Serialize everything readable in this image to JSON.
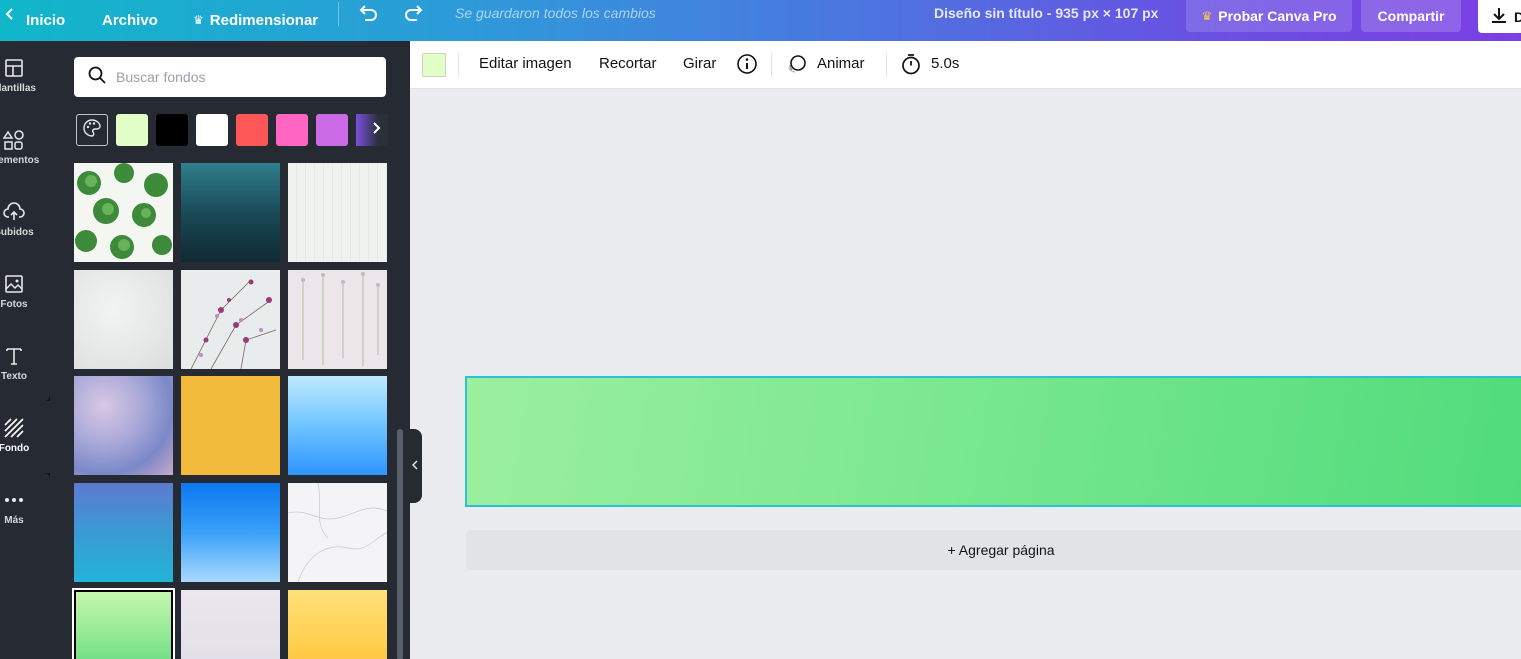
{
  "topbar": {
    "home_label": "Inicio",
    "file_label": "Archivo",
    "resize_label": "Redimensionar",
    "saved_status": "Se guardaron todos los cambios",
    "doc_title": "Diseño sin título - 935 px × 107 px",
    "try_pro_label": "Probar Canva Pro",
    "share_label": "Compartir",
    "download_label": "D"
  },
  "rail": {
    "items": [
      {
        "label": "Plantillas",
        "icon": "template-icon"
      },
      {
        "label": "Elementos",
        "icon": "shapes-icon"
      },
      {
        "label": "Subidos",
        "icon": "upload-cloud-icon"
      },
      {
        "label": "Fotos",
        "icon": "image-icon"
      },
      {
        "label": "Texto",
        "icon": "text-icon"
      },
      {
        "label": "Fondo",
        "icon": "background-stripes-icon"
      },
      {
        "label": "Más",
        "icon": "more-dots-icon"
      }
    ]
  },
  "panel": {
    "search_placeholder": "Buscar fondos",
    "swatch_colors": [
      "#e2ffc8",
      "#000000",
      "#ffffff",
      "#ff5757",
      "#ff66c4",
      "#cb6ce6"
    ]
  },
  "toolbar": {
    "edit_image_label": "Editar imagen",
    "crop_label": "Recortar",
    "flip_label": "Girar",
    "animate_label": "Animar",
    "duration_label": "5.0s",
    "bg_color": "#e2ffc8"
  },
  "canvas": {
    "add_page_label": "+ Agregar página"
  },
  "colors": {
    "accent_border": "#2bc3d2",
    "rail_bg": "#0e1318",
    "panel_bg": "#252a33"
  }
}
